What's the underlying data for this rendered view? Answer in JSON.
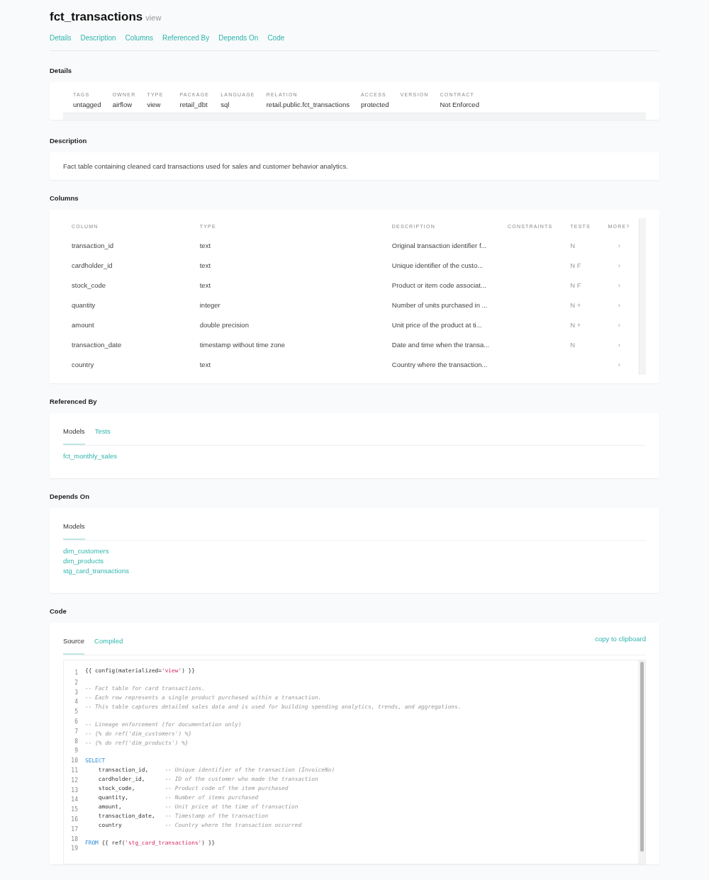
{
  "title": "fct_transactions",
  "subtitle": "view",
  "nav": [
    "Details",
    "Description",
    "Columns",
    "Referenced By",
    "Depends On",
    "Code"
  ],
  "details": {
    "heading": "Details",
    "fields": [
      {
        "label": "TAGS",
        "value": "untagged"
      },
      {
        "label": "OWNER",
        "value": "airflow"
      },
      {
        "label": "TYPE",
        "value": "view"
      },
      {
        "label": "PACKAGE",
        "value": "retail_dbt"
      },
      {
        "label": "LANGUAGE",
        "value": "sql"
      },
      {
        "label": "RELATION",
        "value": "retail.public.fct_transactions"
      },
      {
        "label": "ACCESS",
        "value": "protected"
      },
      {
        "label": "VERSION"
      },
      {
        "label": "CONTRACT",
        "value": "Not Enforced"
      }
    ]
  },
  "description": {
    "heading": "Description",
    "text": "Fact table containing cleaned card transactions used for sales and customer behavior analytics."
  },
  "columns": {
    "heading": "Columns",
    "headers": [
      "COLUMN",
      "TYPE",
      "DESCRIPTION",
      "CONSTRAINTS",
      "TESTS",
      "MORE?"
    ],
    "rows": [
      {
        "column": "transaction_id",
        "type": "text",
        "description": "Original transaction identifier f...",
        "tests": "N",
        "more": "›"
      },
      {
        "column": "cardholder_id",
        "type": "text",
        "description": "Unique identifier of the custo...",
        "tests": "N F",
        "more": "›"
      },
      {
        "column": "stock_code",
        "type": "text",
        "description": "Product or item code associat...",
        "tests": "N F",
        "more": "›"
      },
      {
        "column": "quantity",
        "type": "integer",
        "description": "Number of units purchased in ...",
        "tests": "N +",
        "more": "›"
      },
      {
        "column": "amount",
        "type": "double precision",
        "description": "Unit price of the product at ti...",
        "tests": "N +",
        "more": "›"
      },
      {
        "column": "transaction_date",
        "type": "timestamp without time zone",
        "description": "Date and time when the transa...",
        "tests": "N",
        "more": "›"
      },
      {
        "column": "country",
        "type": "text",
        "description": "Country where the transaction...",
        "more": "›"
      }
    ]
  },
  "referenced_by": {
    "heading": "Referenced By",
    "tabs": [
      {
        "label": "Models",
        "selected": true
      },
      {
        "label": "Tests",
        "selected": false
      }
    ],
    "links": [
      "fct_monthly_sales"
    ]
  },
  "depends_on": {
    "heading": "Depends On",
    "tabs": [
      {
        "label": "Models",
        "selected": true
      }
    ],
    "links": [
      "dim_customers",
      "dim_products",
      "stg_card_transactions"
    ]
  },
  "code": {
    "heading": "Code",
    "tabs": [
      {
        "label": "Source",
        "selected": true
      },
      {
        "label": "Compiled",
        "selected": false
      }
    ],
    "copy": "copy to clipboard",
    "line_numbers": [
      "1",
      "2",
      "3",
      "4",
      "5",
      "6",
      "7",
      "8",
      "9",
      "10",
      "11",
      "12",
      "13",
      "14",
      "15",
      "16",
      "17",
      "18",
      "19"
    ],
    "lines": [
      {
        "tokens": [
          {
            "kind": "plain",
            "text": "{{ config(materialized="
          },
          {
            "kind": "string",
            "text": "'view'"
          },
          {
            "kind": "plain",
            "text": ") }}"
          }
        ]
      },
      {
        "kind": "blank"
      },
      {
        "tokens": [
          {
            "kind": "comment",
            "text": "-- Fact table for card transactions."
          }
        ]
      },
      {
        "tokens": [
          {
            "kind": "comment",
            "text": "-- Each row represents a single product purchased within a transaction."
          }
        ]
      },
      {
        "tokens": [
          {
            "kind": "comment",
            "text": "-- This table captures detailed sales data and is used for building spending analytics, trends, and aggregations."
          }
        ]
      },
      {
        "kind": "blank"
      },
      {
        "tokens": [
          {
            "kind": "comment",
            "text": "-- Lineage enforcement (for documentation only)"
          }
        ]
      },
      {
        "tokens": [
          {
            "kind": "comment",
            "text": "-- {% do ref('dim_customers') %}"
          }
        ]
      },
      {
        "tokens": [
          {
            "kind": "comment",
            "text": "-- {% do ref('dim_products') %}"
          }
        ]
      },
      {
        "kind": "blank"
      },
      {
        "tokens": [
          {
            "kind": "keyword",
            "text": "SELECT"
          }
        ]
      },
      {
        "tokens": [
          {
            "kind": "plain",
            "text": "    transaction_id,     "
          },
          {
            "kind": "comment",
            "text": "-- Unique identifier of the transaction (InvoiceNo)"
          }
        ]
      },
      {
        "tokens": [
          {
            "kind": "plain",
            "text": "    cardholder_id,      "
          },
          {
            "kind": "comment",
            "text": "-- ID of the customer who made the transaction"
          }
        ]
      },
      {
        "tokens": [
          {
            "kind": "plain",
            "text": "    stock_code,         "
          },
          {
            "kind": "comment",
            "text": "-- Product code of the item purchased"
          }
        ]
      },
      {
        "tokens": [
          {
            "kind": "plain",
            "text": "    quantity,           "
          },
          {
            "kind": "comment",
            "text": "-- Number of items purchased"
          }
        ]
      },
      {
        "tokens": [
          {
            "kind": "plain",
            "text": "    amount,             "
          },
          {
            "kind": "comment",
            "text": "-- Unit price at the time of transaction"
          }
        ]
      },
      {
        "tokens": [
          {
            "kind": "plain",
            "text": "    transaction_date,   "
          },
          {
            "kind": "comment",
            "text": "-- Timestamp of the transaction"
          }
        ]
      },
      {
        "tokens": [
          {
            "kind": "plain",
            "text": "    country             "
          },
          {
            "kind": "comment",
            "text": "-- Country where the transaction occurred"
          }
        ]
      },
      {
        "kind": "blank"
      },
      {
        "tokens": [
          {
            "kind": "keyword",
            "text": "FROM"
          },
          {
            "kind": "plain",
            "text": " {{ ref("
          },
          {
            "kind": "string",
            "text": "'stg_card_transactions'"
          },
          {
            "kind": "plain",
            "text": ") }}"
          }
        ]
      }
    ]
  }
}
